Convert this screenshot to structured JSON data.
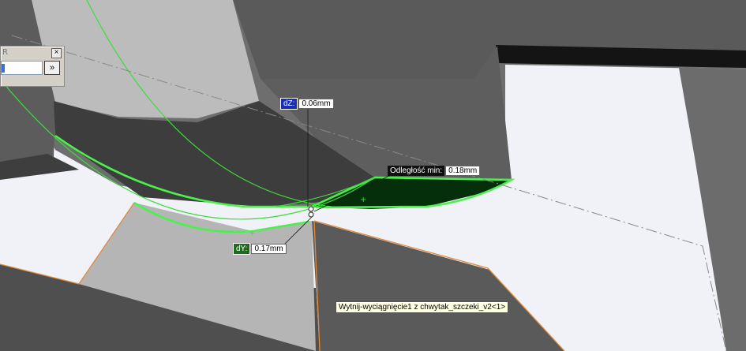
{
  "panel": {
    "title_letter": "R",
    "close_symbol": "×",
    "expand_symbol": "»"
  },
  "measurements": {
    "dz": {
      "label": "dZ:",
      "value": "0.06mm"
    },
    "min_distance": {
      "label": "Odległość min:",
      "value": "0.18mm"
    },
    "dy": {
      "label": "dY:",
      "value": "0.17mm"
    }
  },
  "tooltip": {
    "text": "Wytnij-wyciągnięcie1 z chwytak_szczeki_v2<1>"
  },
  "colors": {
    "highlight_green": "#3cdc3c",
    "edge_orange": "#e08a3a",
    "dz_tag": "#1a2fb0",
    "dy_tag": "#1e6b1e"
  }
}
